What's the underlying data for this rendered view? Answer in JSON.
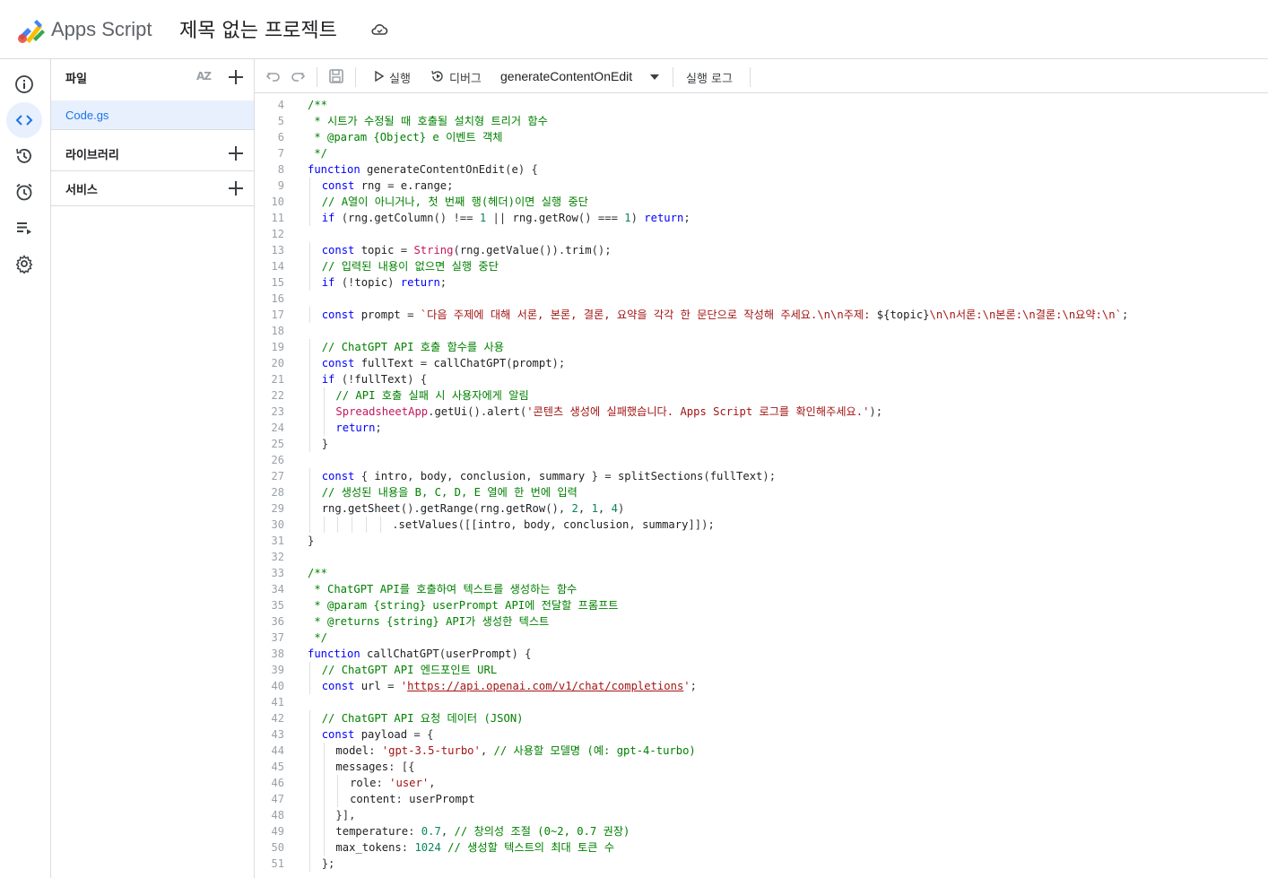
{
  "header": {
    "app_name": "Apps Script",
    "project_title": "제목 없는 프로젝트"
  },
  "rail": {
    "items": [
      {
        "icon": "info-icon",
        "label": "Overview"
      },
      {
        "icon": "code-icon",
        "label": "Editor",
        "active": true
      },
      {
        "icon": "history-icon",
        "label": "History"
      },
      {
        "icon": "alarm-icon",
        "label": "Triggers"
      },
      {
        "icon": "executions-icon",
        "label": "Executions"
      },
      {
        "icon": "gear-icon",
        "label": "Settings"
      }
    ]
  },
  "files_panel": {
    "files_label": "파일",
    "sort_label": "AZ",
    "file_name": "Code.gs",
    "libraries_label": "라이브러리",
    "services_label": "서비스"
  },
  "toolbar": {
    "run_label": "실행",
    "debug_label": "디버그",
    "function_name": "generateContentOnEdit",
    "log_label": "실행 로그"
  },
  "colors": {
    "accent": "#1a73e8",
    "selected_bg": "#e8f0fe",
    "keyword": "#0000ff",
    "comment": "#008000",
    "string": "#a31515",
    "number": "#098658"
  },
  "editor": {
    "lines": [
      {
        "n": "4",
        "indent": 0,
        "t": [
          [
            "cmt",
            "/**"
          ]
        ]
      },
      {
        "n": "5",
        "indent": 0,
        "t": [
          [
            "cmt",
            " * 시트가 수정될 때 호출될 설치형 트리거 함수"
          ]
        ]
      },
      {
        "n": "6",
        "indent": 0,
        "t": [
          [
            "cmt",
            " * @param {Object} e 이벤트 객체"
          ]
        ]
      },
      {
        "n": "7",
        "indent": 0,
        "t": [
          [
            "cmt",
            " */"
          ]
        ]
      },
      {
        "n": "8",
        "indent": 0,
        "t": [
          [
            "kw",
            "function "
          ],
          [
            "pl",
            "generateContentOnEdit"
          ],
          [
            "op",
            "("
          ],
          [
            "pl",
            "e"
          ],
          [
            "op",
            ") {"
          ]
        ]
      },
      {
        "n": "9",
        "indent": 1,
        "t": [
          [
            "kw",
            "const "
          ],
          [
            "pl",
            "rng "
          ],
          [
            "op",
            "= "
          ],
          [
            "pl",
            "e.range"
          ],
          [
            "op",
            ";"
          ]
        ]
      },
      {
        "n": "10",
        "indent": 1,
        "t": [
          [
            "cmt",
            "// A열이 아니거나, 첫 번째 행(헤더)이면 실행 중단"
          ]
        ]
      },
      {
        "n": "11",
        "indent": 1,
        "t": [
          [
            "kw",
            "if "
          ],
          [
            "op",
            "("
          ],
          [
            "pl",
            "rng.getColumn"
          ],
          [
            "op",
            "() !== "
          ],
          [
            "num",
            "1"
          ],
          [
            "op",
            " || "
          ],
          [
            "pl",
            "rng.getRow"
          ],
          [
            "op",
            "() === "
          ],
          [
            "num",
            "1"
          ],
          [
            "op",
            ") "
          ],
          [
            "kw",
            "return"
          ],
          [
            "op",
            ";"
          ]
        ]
      },
      {
        "n": "12",
        "indent": 0,
        "t": []
      },
      {
        "n": "13",
        "indent": 1,
        "t": [
          [
            "kw",
            "const "
          ],
          [
            "pl",
            "topic "
          ],
          [
            "op",
            "= "
          ],
          [
            "cls",
            "String"
          ],
          [
            "op",
            "("
          ],
          [
            "pl",
            "rng.getValue"
          ],
          [
            "op",
            "())."
          ],
          [
            "pl",
            "trim"
          ],
          [
            "op",
            "();"
          ]
        ]
      },
      {
        "n": "14",
        "indent": 1,
        "t": [
          [
            "cmt",
            "// 입력된 내용이 없으면 실행 중단"
          ]
        ]
      },
      {
        "n": "15",
        "indent": 1,
        "t": [
          [
            "kw",
            "if "
          ],
          [
            "op",
            "(!"
          ],
          [
            "pl",
            "topic"
          ],
          [
            "op",
            ") "
          ],
          [
            "kw",
            "return"
          ],
          [
            "op",
            ";"
          ]
        ]
      },
      {
        "n": "16",
        "indent": 0,
        "t": []
      },
      {
        "n": "17",
        "indent": 1,
        "t": [
          [
            "kw",
            "const "
          ],
          [
            "pl",
            "prompt "
          ],
          [
            "op",
            "= "
          ],
          [
            "tpl",
            "`다음 주제에 대해 서론, 본론, 결론, 요약을 각각 한 문단으로 작성해 주세요.\\n\\n주제: "
          ],
          [
            "pl",
            "${topic}"
          ],
          [
            "tpl",
            "\\n\\n서론:\\n본론:\\n결론:\\n요약:\\n`"
          ],
          [
            "op",
            ";"
          ]
        ]
      },
      {
        "n": "18",
        "indent": 0,
        "t": []
      },
      {
        "n": "19",
        "indent": 1,
        "t": [
          [
            "cmt",
            "// ChatGPT API 호출 함수를 사용"
          ]
        ]
      },
      {
        "n": "20",
        "indent": 1,
        "t": [
          [
            "kw",
            "const "
          ],
          [
            "pl",
            "fullText "
          ],
          [
            "op",
            "= "
          ],
          [
            "pl",
            "callChatGPT"
          ],
          [
            "op",
            "("
          ],
          [
            "pl",
            "prompt"
          ],
          [
            "op",
            ");"
          ]
        ]
      },
      {
        "n": "21",
        "indent": 1,
        "t": [
          [
            "kw",
            "if "
          ],
          [
            "op",
            "(!"
          ],
          [
            "pl",
            "fullText"
          ],
          [
            "op",
            ") {"
          ]
        ]
      },
      {
        "n": "22",
        "indent": 2,
        "t": [
          [
            "cmt",
            "// API 호출 실패 시 사용자에게 알림"
          ]
        ]
      },
      {
        "n": "23",
        "indent": 2,
        "t": [
          [
            "cls",
            "SpreadsheetApp"
          ],
          [
            "op",
            "."
          ],
          [
            "pl",
            "getUi"
          ],
          [
            "op",
            "()."
          ],
          [
            "pl",
            "alert"
          ],
          [
            "op",
            "("
          ],
          [
            "str",
            "'콘텐츠 생성에 실패했습니다. Apps Script 로그를 확인해주세요.'"
          ],
          [
            "op",
            ");"
          ]
        ]
      },
      {
        "n": "24",
        "indent": 2,
        "t": [
          [
            "kw",
            "return"
          ],
          [
            "op",
            ";"
          ]
        ]
      },
      {
        "n": "25",
        "indent": 1,
        "t": [
          [
            "op",
            "}"
          ]
        ]
      },
      {
        "n": "26",
        "indent": 0,
        "t": []
      },
      {
        "n": "27",
        "indent": 1,
        "t": [
          [
            "kw",
            "const "
          ],
          [
            "op",
            "{ "
          ],
          [
            "pl",
            "intro"
          ],
          [
            "op",
            ", "
          ],
          [
            "pl",
            "body"
          ],
          [
            "op",
            ", "
          ],
          [
            "pl",
            "conclusion"
          ],
          [
            "op",
            ", "
          ],
          [
            "pl",
            "summary"
          ],
          [
            "op",
            " } = "
          ],
          [
            "pl",
            "splitSections"
          ],
          [
            "op",
            "("
          ],
          [
            "pl",
            "fullText"
          ],
          [
            "op",
            ");"
          ]
        ]
      },
      {
        "n": "28",
        "indent": 1,
        "t": [
          [
            "cmt",
            "// 생성된 내용을 B, C, D, E 열에 한 번에 입력"
          ]
        ]
      },
      {
        "n": "29",
        "indent": 1,
        "t": [
          [
            "pl",
            "rng.getSheet"
          ],
          [
            "op",
            "()."
          ],
          [
            "pl",
            "getRange"
          ],
          [
            "op",
            "("
          ],
          [
            "pl",
            "rng.getRow"
          ],
          [
            "op",
            "(), "
          ],
          [
            "num",
            "2"
          ],
          [
            "op",
            ", "
          ],
          [
            "num",
            "1"
          ],
          [
            "op",
            ", "
          ],
          [
            "num",
            "4"
          ],
          [
            "op",
            ")"
          ]
        ]
      },
      {
        "n": "30",
        "indent": 6,
        "t": [
          [
            "op",
            "."
          ],
          [
            "pl",
            "setValues"
          ],
          [
            "op",
            "([["
          ],
          [
            "pl",
            "intro"
          ],
          [
            "op",
            ", "
          ],
          [
            "pl",
            "body"
          ],
          [
            "op",
            ", "
          ],
          [
            "pl",
            "conclusion"
          ],
          [
            "op",
            ", "
          ],
          [
            "pl",
            "summary"
          ],
          [
            "op",
            "]]);"
          ]
        ]
      },
      {
        "n": "31",
        "indent": 0,
        "t": [
          [
            "op",
            "}"
          ]
        ]
      },
      {
        "n": "32",
        "indent": 0,
        "t": []
      },
      {
        "n": "33",
        "indent": 0,
        "t": [
          [
            "cmt",
            "/**"
          ]
        ]
      },
      {
        "n": "34",
        "indent": 0,
        "t": [
          [
            "cmt",
            " * ChatGPT API를 호출하여 텍스트를 생성하는 함수"
          ]
        ]
      },
      {
        "n": "35",
        "indent": 0,
        "t": [
          [
            "cmt",
            " * @param {string} userPrompt API에 전달할 프롬프트"
          ]
        ]
      },
      {
        "n": "36",
        "indent": 0,
        "t": [
          [
            "cmt",
            " * @returns {string} API가 생성한 텍스트"
          ]
        ]
      },
      {
        "n": "37",
        "indent": 0,
        "t": [
          [
            "cmt",
            " */"
          ]
        ]
      },
      {
        "n": "38",
        "indent": 0,
        "t": [
          [
            "kw",
            "function "
          ],
          [
            "pl",
            "callChatGPT"
          ],
          [
            "op",
            "("
          ],
          [
            "pl",
            "userPrompt"
          ],
          [
            "op",
            ") {"
          ]
        ]
      },
      {
        "n": "39",
        "indent": 1,
        "t": [
          [
            "cmt",
            "// ChatGPT API 엔드포인트 URL"
          ]
        ]
      },
      {
        "n": "40",
        "indent": 1,
        "t": [
          [
            "kw",
            "const "
          ],
          [
            "pl",
            "url "
          ],
          [
            "op",
            "= "
          ],
          [
            "str",
            "'"
          ],
          [
            "url",
            "https://api.openai.com/v1/chat/completions"
          ],
          [
            "str",
            "'"
          ],
          [
            "op",
            ";"
          ]
        ]
      },
      {
        "n": "41",
        "indent": 0,
        "t": []
      },
      {
        "n": "42",
        "indent": 1,
        "t": [
          [
            "cmt",
            "// ChatGPT API 요청 데이터 (JSON)"
          ]
        ]
      },
      {
        "n": "43",
        "indent": 1,
        "t": [
          [
            "kw",
            "const "
          ],
          [
            "pl",
            "payload "
          ],
          [
            "op",
            "= {"
          ]
        ]
      },
      {
        "n": "44",
        "indent": 2,
        "t": [
          [
            "pl",
            "model"
          ],
          [
            "op",
            ": "
          ],
          [
            "str",
            "'gpt-3.5-turbo'"
          ],
          [
            "op",
            ", "
          ],
          [
            "cmt",
            "// 사용할 모델명 (예: gpt-4-turbo)"
          ]
        ]
      },
      {
        "n": "45",
        "indent": 2,
        "t": [
          [
            "pl",
            "messages"
          ],
          [
            "op",
            ": [{"
          ]
        ]
      },
      {
        "n": "46",
        "indent": 3,
        "t": [
          [
            "pl",
            "role"
          ],
          [
            "op",
            ": "
          ],
          [
            "str",
            "'user'"
          ],
          [
            "op",
            ","
          ]
        ]
      },
      {
        "n": "47",
        "indent": 3,
        "t": [
          [
            "pl",
            "content"
          ],
          [
            "op",
            ": "
          ],
          [
            "pl",
            "userPrompt"
          ]
        ]
      },
      {
        "n": "48",
        "indent": 2,
        "t": [
          [
            "op",
            "}],"
          ]
        ]
      },
      {
        "n": "49",
        "indent": 2,
        "t": [
          [
            "pl",
            "temperature"
          ],
          [
            "op",
            ": "
          ],
          [
            "num",
            "0.7"
          ],
          [
            "op",
            ", "
          ],
          [
            "cmt",
            "// 창의성 조절 (0~2, 0.7 권장)"
          ]
        ]
      },
      {
        "n": "50",
        "indent": 2,
        "t": [
          [
            "pl",
            "max_tokens"
          ],
          [
            "op",
            ": "
          ],
          [
            "num",
            "1024"
          ],
          [
            "op",
            " "
          ],
          [
            "cmt",
            "// 생성할 텍스트의 최대 토큰 수"
          ]
        ]
      },
      {
        "n": "51",
        "indent": 1,
        "t": [
          [
            "op",
            "};"
          ]
        ]
      }
    ]
  }
}
